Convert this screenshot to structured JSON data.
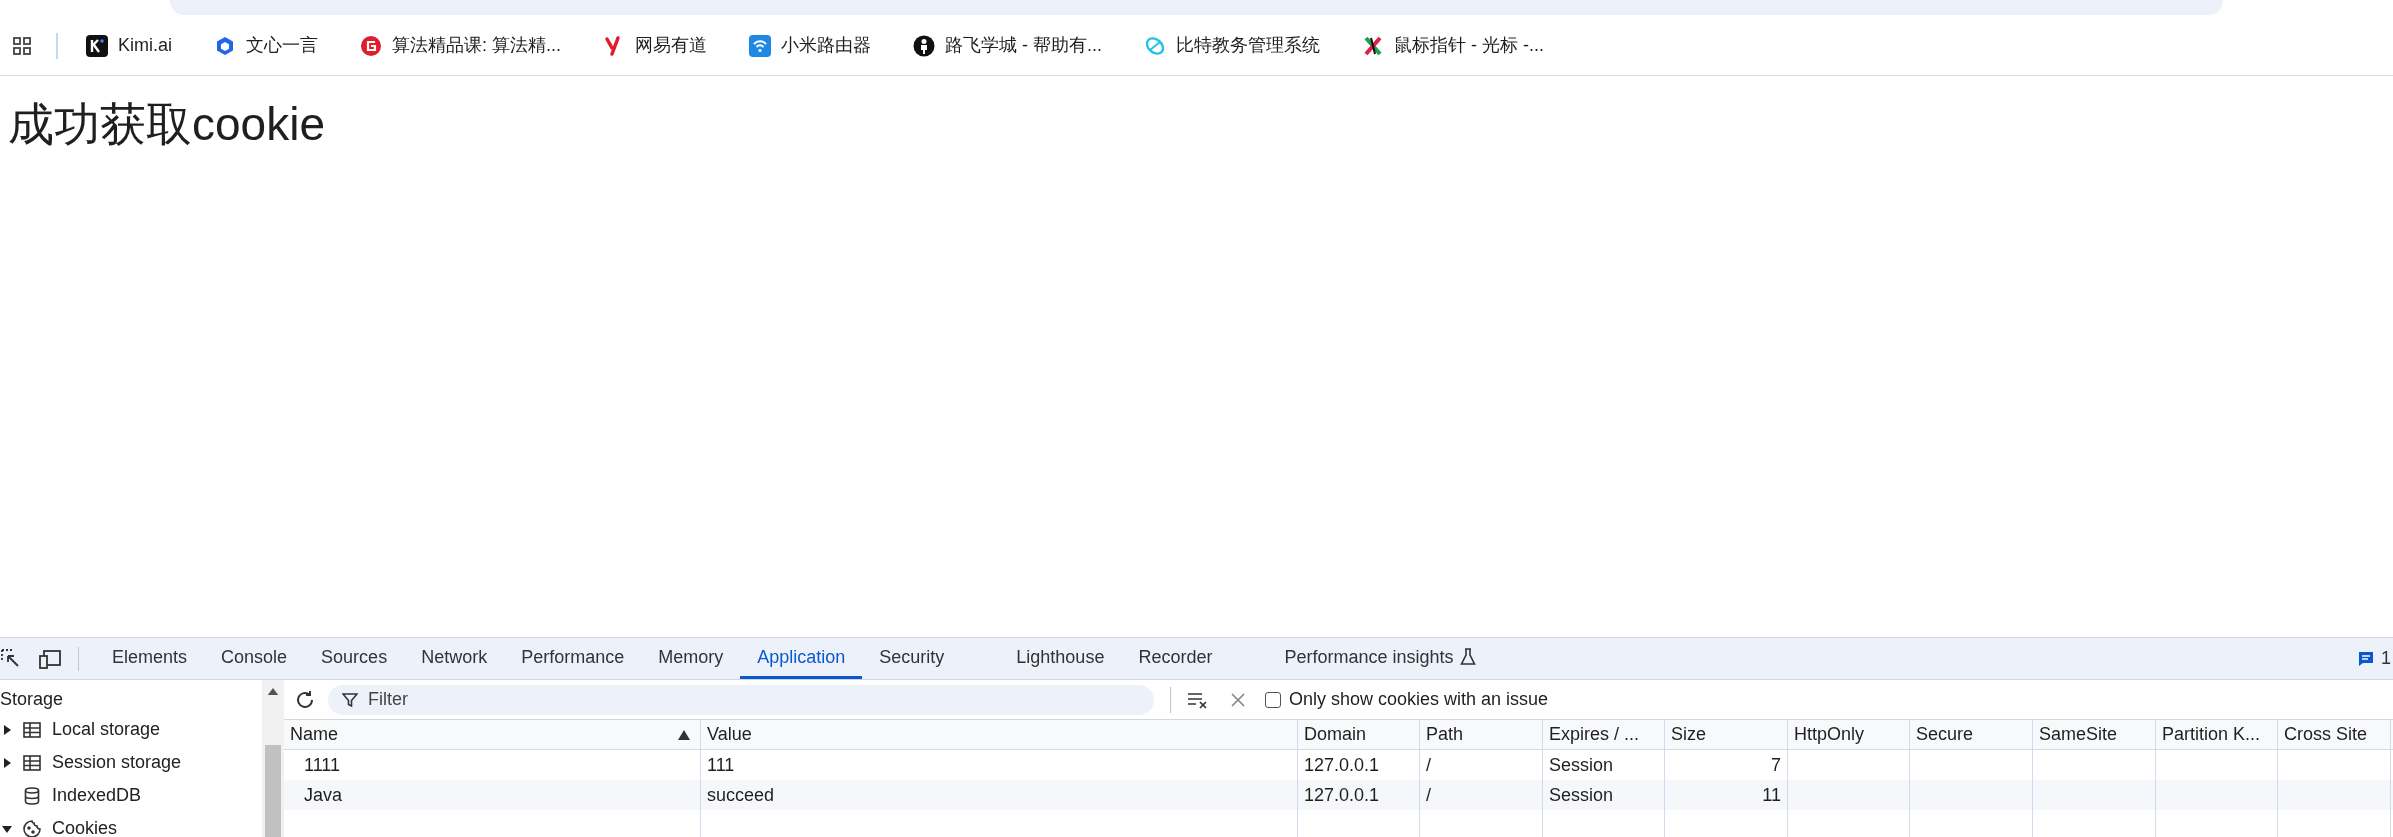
{
  "bookmarks": [
    {
      "label": "Kimi.ai"
    },
    {
      "label": "文心一言"
    },
    {
      "label": "算法精品课: 算法精..."
    },
    {
      "label": "网易有道"
    },
    {
      "label": "小米路由器"
    },
    {
      "label": "路飞学城 - 帮助有..."
    },
    {
      "label": "比特教务管理系统"
    },
    {
      "label": "鼠标指针 - 光标 -..."
    }
  ],
  "page": {
    "heading": "成功获取cookie"
  },
  "devtools": {
    "tabs": [
      {
        "label": "Elements",
        "selected": false
      },
      {
        "label": "Console",
        "selected": false
      },
      {
        "label": "Sources",
        "selected": false
      },
      {
        "label": "Network",
        "selected": false
      },
      {
        "label": "Performance",
        "selected": false
      },
      {
        "label": "Memory",
        "selected": false
      },
      {
        "label": "Application",
        "selected": true
      },
      {
        "label": "Security",
        "selected": false
      },
      {
        "label": "Lighthouse",
        "selected": false
      },
      {
        "label": "Recorder",
        "selected": false
      },
      {
        "label": "Performance insights",
        "selected": false
      }
    ],
    "issues_count": "1",
    "sidebar": {
      "heading": "Storage",
      "items": [
        {
          "label": "Local storage",
          "kind": "table",
          "expanded": false
        },
        {
          "label": "Session storage",
          "kind": "table",
          "expanded": false
        },
        {
          "label": "IndexedDB",
          "kind": "database"
        },
        {
          "label": "Cookies",
          "kind": "cookie",
          "expanded": true
        }
      ]
    },
    "toolbar": {
      "filter_placeholder": "Filter",
      "only_issues": {
        "label": "Only show cookies with an issue",
        "checked": false
      }
    },
    "table": {
      "columns": [
        {
          "label": "Name",
          "sorted": true
        },
        {
          "label": "Value",
          "sorted": false
        },
        {
          "label": "Domain",
          "sorted": false
        },
        {
          "label": "Path",
          "sorted": false
        },
        {
          "label": "Expires / ...",
          "sorted": false
        },
        {
          "label": "Size",
          "sorted": false
        },
        {
          "label": "HttpOnly",
          "sorted": false
        },
        {
          "label": "Secure",
          "sorted": false
        },
        {
          "label": "SameSite",
          "sorted": false
        },
        {
          "label": "Partition K...",
          "sorted": false
        },
        {
          "label": "Cross Site",
          "sorted": false
        }
      ],
      "rows": [
        [
          "1111",
          "111",
          "127.0.0.1",
          "/",
          "Session",
          "7"
        ],
        [
          "Java",
          "succeed",
          "127.0.0.1",
          "/",
          "Session",
          "11"
        ]
      ]
    }
  }
}
